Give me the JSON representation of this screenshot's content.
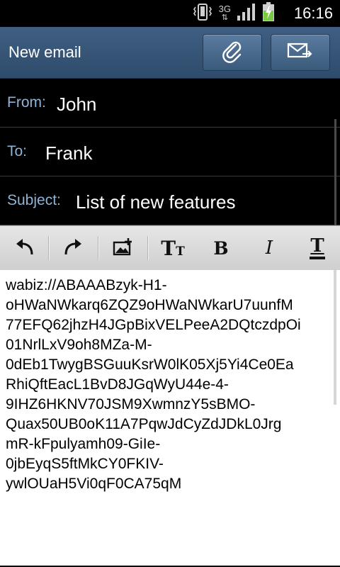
{
  "status_bar": {
    "time": "16:16",
    "network": "3G",
    "icons": [
      "vibrate-icon",
      "network-3g-icon",
      "signal-icon",
      "battery-charging-icon"
    ]
  },
  "action_bar": {
    "title": "New email",
    "buttons": [
      "attach-icon",
      "send-icon"
    ]
  },
  "fields": {
    "from_label": "From:",
    "from_value": "John",
    "to_label": "To:",
    "to_value": "Frank",
    "subject_label": "Subject:",
    "subject_value": "List of new features"
  },
  "toolbar": {
    "buttons": [
      "undo-icon",
      "redo-icon",
      "insert-image-icon",
      "font-size-icon",
      "bold-icon",
      "italic-icon",
      "text-color-icon"
    ],
    "bold_glyph": "B",
    "italic_glyph": "I",
    "font_size_glyph": "TT",
    "text_color_glyph": "T"
  },
  "body": {
    "lines": [
      "wabiz://ABAAABzyk-H1-",
      "oHWaNWkarq6ZQZ9oHWaNWkarU7uunfM",
      "77EFQ62jhzH4JGpBixVELPeeA2DQtczdpOi",
      "01NrlLxV9oh8MZa-M-",
      "0dEb1TwygBSGuuKsrW0lK05Xj5Yi4Ce0Ea",
      "RhiQftEacL1BvD8JGqWyU44e-4-",
      "9IHZ6HKNV70JSM9XwmnzY5sBMO-",
      "Quax50UB0oK11A7PqwJdCyZdJDkL0Jrg",
      "mR-kFpulyamh09-GiIe-",
      "0jbEyqS5ftMkCY0FKIV-",
      "ywlOUaH5Vi0qF0CA75qM"
    ]
  },
  "colors": {
    "action_bar": "#34527a",
    "field_label": "#8fb3d6",
    "background": "#000000"
  }
}
